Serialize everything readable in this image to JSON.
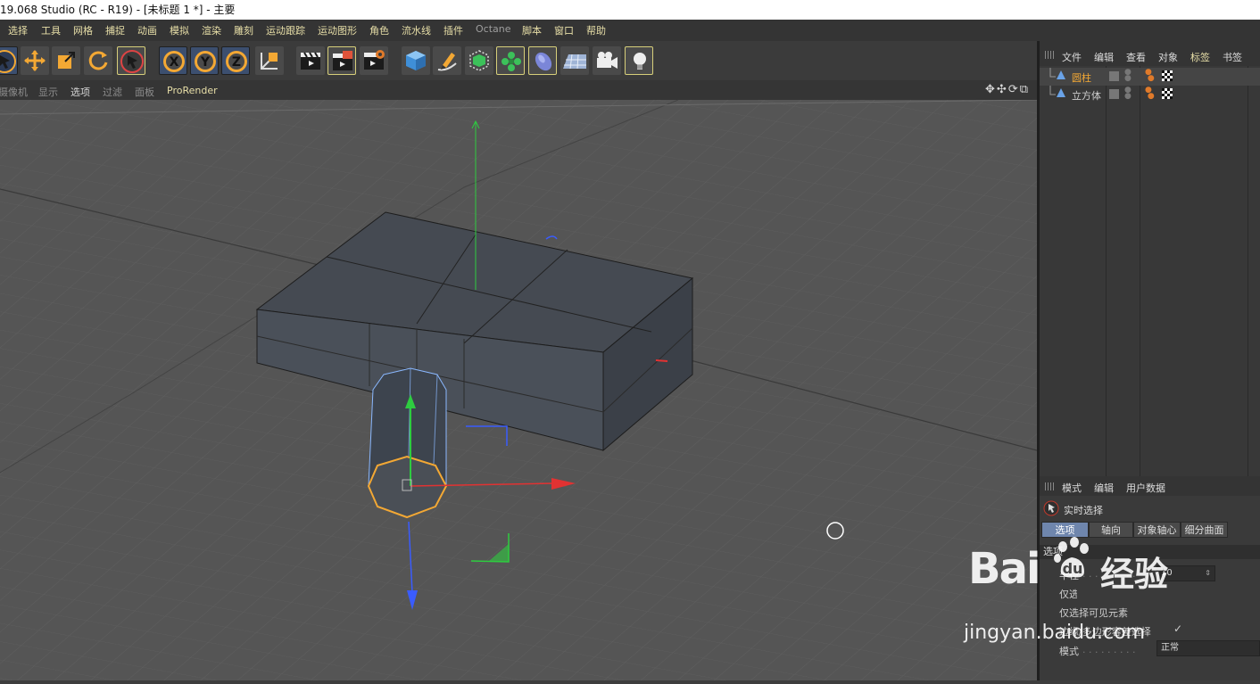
{
  "window": {
    "title": "19.068 Studio (RC - R19) - [未标题 1 *] - 主要"
  },
  "menubar": {
    "items": [
      "选择",
      "工具",
      "网格",
      "捕捉",
      "动画",
      "模拟",
      "渲染",
      "雕刻",
      "运动跟踪",
      "运动图形",
      "角色",
      "流水线",
      "插件",
      "Octane",
      "脚本",
      "窗口",
      "帮助"
    ]
  },
  "toolbar": {
    "groups": [
      {
        "buttons": [
          "live-selection",
          "move",
          "scale",
          "rotate",
          "recent-tool"
        ]
      },
      {
        "buttons": [
          "lock-x",
          "lock-y",
          "lock-z",
          "coordinate-system"
        ]
      },
      {
        "buttons": [
          "render-view",
          "render-to-picture-viewer",
          "render-settings"
        ]
      },
      {
        "buttons": [
          "cube",
          "pen-spline",
          "subdivision-surface",
          "cloner",
          "deformer",
          "floor",
          "camera",
          "light"
        ]
      }
    ]
  },
  "viewport_menu": {
    "items": [
      "摄像机",
      "显示",
      "选项",
      "过滤",
      "面板",
      "ProRender"
    ],
    "active_index": 5
  },
  "object_manager": {
    "tabs": [
      "文件",
      "编辑",
      "查看",
      "对象",
      "标签",
      "书签"
    ],
    "active_tab": 4,
    "objects": [
      {
        "name": "圆柱",
        "icon": "cylinder-icon",
        "selected": true
      },
      {
        "name": "立方体",
        "icon": "cube-icon",
        "selected": false
      }
    ]
  },
  "attribute_manager": {
    "tabs": [
      "模式",
      "编辑",
      "用户数据"
    ],
    "tool_name": "实时选择",
    "subtabs": [
      "选项",
      "轴向",
      "对象轴心",
      "细分曲面"
    ],
    "active_subtab": 0,
    "section": "选项",
    "properties": [
      {
        "label": "半径",
        "value": "10"
      },
      {
        "label": "仅选择可见元素",
        "value": ""
      },
      {
        "label": "边缘/多边形容差选择",
        "value": ""
      },
      {
        "label": "模式",
        "value": "正常"
      }
    ]
  },
  "watermark": {
    "brand": "Bai",
    "suffix": "经验",
    "url": "jingyan.baidu.com"
  },
  "colors": {
    "accent_orange": "#f3a834",
    "menu_text": "#e8dfa8",
    "axis_x": "#e23232",
    "axis_y": "#2ecc40",
    "axis_z": "#3a5cff",
    "selection_blue": "#6f86ad"
  }
}
